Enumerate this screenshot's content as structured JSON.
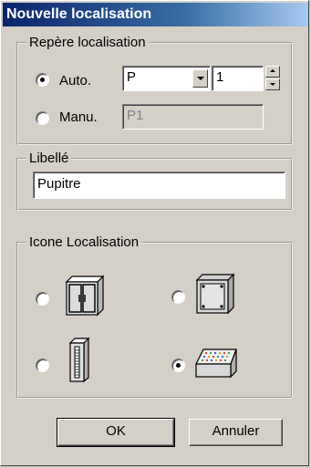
{
  "window": {
    "title": "Nouvelle localisation"
  },
  "repere": {
    "legend": "Repère localisation",
    "auto_label": "Auto.",
    "manu_label": "Manu.",
    "prefix_value": "P",
    "number_value": "1",
    "manual_value": "P1",
    "selected": "auto"
  },
  "libelle": {
    "legend": "Libellé",
    "value": "Pupitre"
  },
  "icone": {
    "legend": "Icone Localisation",
    "options": [
      {
        "icon": "cabinet-icon",
        "selected": false
      },
      {
        "icon": "box-icon",
        "selected": false
      },
      {
        "icon": "rack-icon",
        "selected": false
      },
      {
        "icon": "desk-console-icon",
        "selected": true
      }
    ]
  },
  "buttons": {
    "ok_label": "OK",
    "cancel_label": "Annuler"
  }
}
